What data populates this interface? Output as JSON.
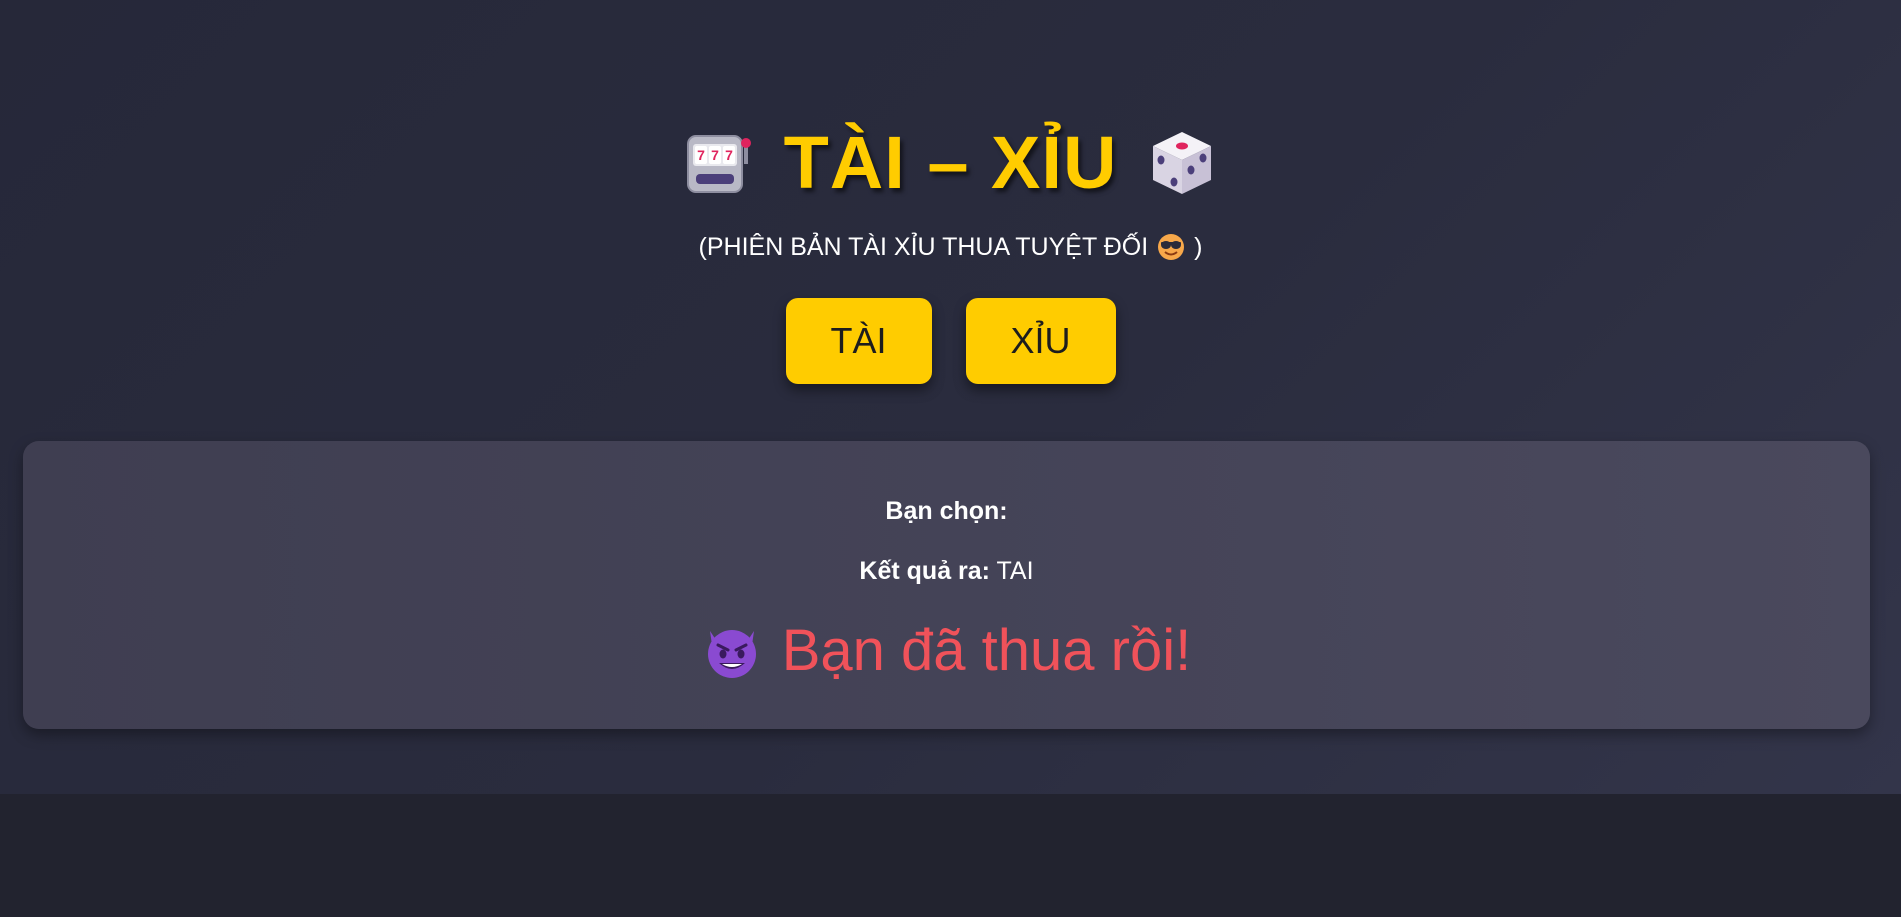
{
  "header": {
    "title": "TÀI – XỈU",
    "left_icon": "slot-machine-icon",
    "right_icon": "dice-icon",
    "subtitle_text": "(PHIÊN BẢN TÀI XỈU THUA TUYỆT ĐỐI",
    "subtitle_close": ")",
    "subtitle_icon": "cool-face-icon"
  },
  "buttons": {
    "tai_label": "TÀI",
    "xiu_label": "XỈU"
  },
  "result": {
    "choice_label": "Bạn chọn:",
    "choice_value": "",
    "outcome_label": "Kết quả ra:",
    "outcome_value": "TAI",
    "message": "Bạn đã thua rồi!",
    "message_icon": "devil-face-icon"
  },
  "colors": {
    "accent": "#ffcc00",
    "lose": "#f0525a",
    "background": "#262839",
    "card": "#444357"
  }
}
